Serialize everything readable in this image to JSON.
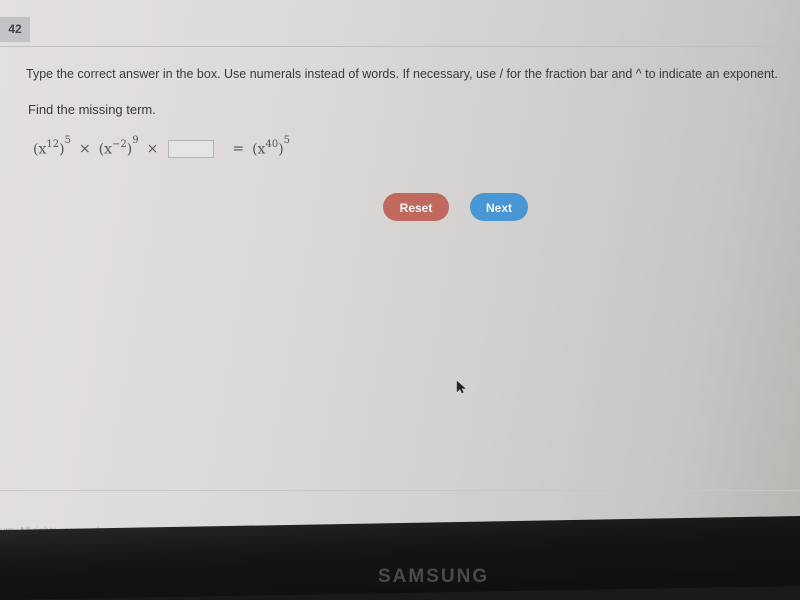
{
  "header": {
    "question_number": "42"
  },
  "question": {
    "instructions": "Type the correct answer in the box. Use numerals instead of words. If necessary, use / for the fraction bar and ^ to indicate an exponent.",
    "prompt": "Find the missing term.",
    "equation": {
      "term1_base": "(x",
      "term1_inner_exp": "12",
      "term1_close": ")",
      "term1_outer_exp": "5",
      "times": "×",
      "term2_base": "(x",
      "term2_inner_exp": "−2",
      "term2_close": ")",
      "term2_outer_exp": "9",
      "equals": "=",
      "rhs_base": "(x",
      "rhs_inner_exp": "40",
      "rhs_close": ")",
      "rhs_outer_exp": "5"
    },
    "answer": {
      "value": "",
      "placeholder": ""
    }
  },
  "buttons": {
    "reset_label": "Reset",
    "next_label": "Next",
    "reset_color": "#c1695e",
    "next_color": "#4896d4"
  },
  "footer": {
    "copyright": "um. All rights reserved."
  },
  "monitor": {
    "brand": "SAMSUNG"
  }
}
